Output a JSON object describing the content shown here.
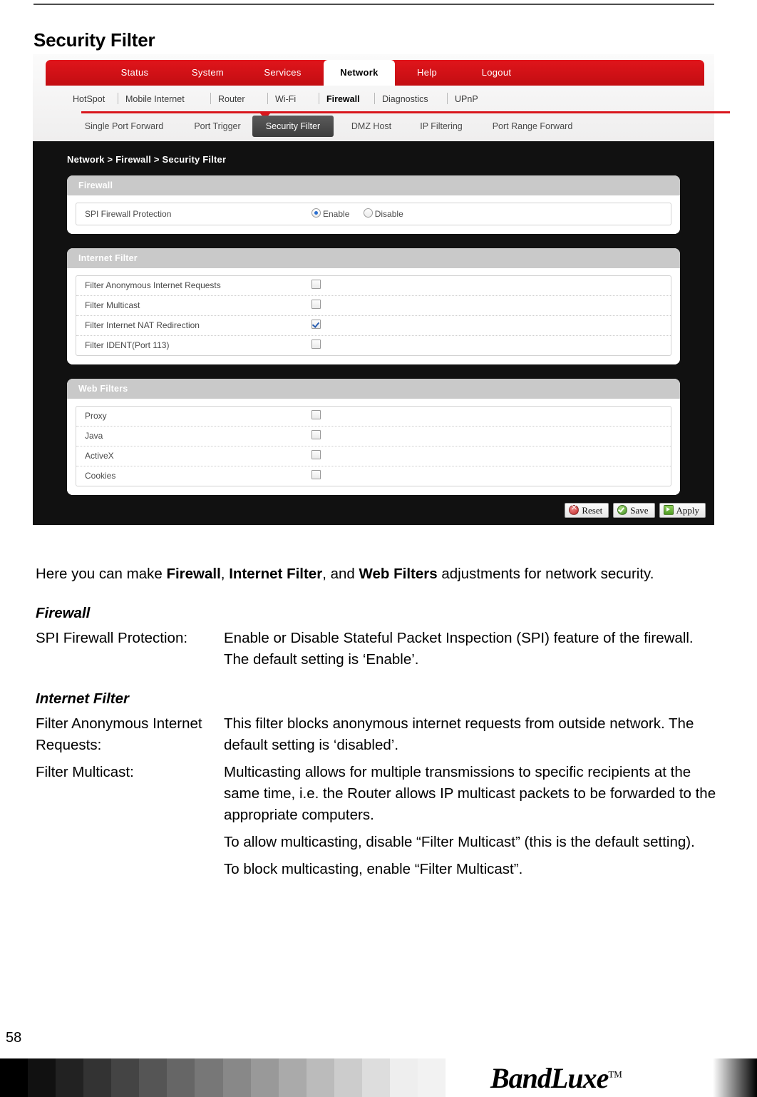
{
  "page": {
    "title": "Security Filter",
    "number": "58"
  },
  "screenshot": {
    "main_tabs": [
      {
        "label": "Status",
        "active": false
      },
      {
        "label": "System",
        "active": false
      },
      {
        "label": "Services",
        "active": false
      },
      {
        "label": "Network",
        "active": true
      },
      {
        "label": "Help",
        "active": false
      },
      {
        "label": "Logout",
        "active": false
      }
    ],
    "sub_nav": [
      {
        "label": "HotSpot",
        "active": false
      },
      {
        "label": "Mobile Internet",
        "active": false
      },
      {
        "label": "Router",
        "active": false
      },
      {
        "label": "Wi-Fi",
        "active": false
      },
      {
        "label": "Firewall",
        "active": true
      },
      {
        "label": "Diagnostics",
        "active": false
      },
      {
        "label": "UPnP",
        "active": false
      }
    ],
    "third_nav": [
      {
        "label": "Single Port Forward",
        "active": false
      },
      {
        "label": "Port Trigger",
        "active": false
      },
      {
        "label": "Security Filter",
        "active": true
      },
      {
        "label": "DMZ Host",
        "active": false
      },
      {
        "label": "IP Filtering",
        "active": false
      },
      {
        "label": "Port Range Forward",
        "active": false
      }
    ],
    "breadcrumb": "Network > Firewall > Security Filter",
    "panels": {
      "firewall": {
        "header": "Firewall",
        "rows": [
          {
            "label": "SPI Firewall Protection",
            "type": "radio",
            "options": [
              {
                "label": "Enable",
                "selected": true
              },
              {
                "label": "Disable",
                "selected": false
              }
            ]
          }
        ]
      },
      "internet_filter": {
        "header": "Internet Filter",
        "rows": [
          {
            "label": "Filter Anonymous Internet Requests",
            "type": "checkbox",
            "checked": false
          },
          {
            "label": "Filter Multicast",
            "type": "checkbox",
            "checked": false
          },
          {
            "label": "Filter Internet NAT Redirection",
            "type": "checkbox",
            "checked": true
          },
          {
            "label": "Filter IDENT(Port 113)",
            "type": "checkbox",
            "checked": false
          }
        ]
      },
      "web_filters": {
        "header": "Web Filters",
        "rows": [
          {
            "label": "Proxy",
            "type": "checkbox",
            "checked": false
          },
          {
            "label": "Java",
            "type": "checkbox",
            "checked": false
          },
          {
            "label": "ActiveX",
            "type": "checkbox",
            "checked": false
          },
          {
            "label": "Cookies",
            "type": "checkbox",
            "checked": false
          }
        ]
      }
    },
    "buttons": [
      {
        "label": "Reset",
        "icon": "reset-icon"
      },
      {
        "label": "Save",
        "icon": "save-icon"
      },
      {
        "label": "Apply",
        "icon": "apply-icon"
      }
    ]
  },
  "body": {
    "intro": {
      "t1": "Here you can make ",
      "b1": "Firewall",
      "t2": ", ",
      "b2": "Internet Filter",
      "t3": ", and ",
      "b3": "Web Filters",
      "t4": " adjustments for network security."
    },
    "sections": [
      {
        "heading": "Firewall",
        "entries": [
          {
            "term": "SPI Firewall Protection:",
            "paragraphs": [
              "Enable or Disable Stateful Packet Inspection (SPI) feature of the firewall. The default setting is ‘Enable’."
            ]
          }
        ]
      },
      {
        "heading": "Internet Filter",
        "entries": [
          {
            "term": "Filter Anonymous Internet Requests:",
            "paragraphs": [
              "This filter blocks anonymous internet requests from outside network. The default setting is ‘disabled’."
            ]
          },
          {
            "term": "Filter Multicast:",
            "paragraphs": [
              "Multicasting allows for multiple transmissions to specific recipients at the same time, i.e. the Router allows IP multicast packets to be forwarded to the appropriate computers.",
              "To allow multicasting, disable “Filter Multicast” (this is the default setting).",
              "To block multicasting, enable “Filter Multicast”."
            ]
          }
        ]
      }
    ]
  },
  "footer": {
    "brand": "BandLuxe",
    "trademark": "TM",
    "grayscale_steps": [
      "#000000",
      "#111111",
      "#222222",
      "#333333",
      "#444444",
      "#555555",
      "#666666",
      "#777777",
      "#888888",
      "#999999",
      "#aaaaaa",
      "#bbbbbb",
      "#cccccc",
      "#dddddd",
      "#eeeeee",
      "#f2f2f2"
    ]
  },
  "colors": {
    "brand_red": "#d9161c",
    "panel_header_gray": "#c9c9c9",
    "dark_bg": "#111111",
    "radio_blue": "#2b6fd0",
    "check_blue": "#2b5fb2"
  }
}
